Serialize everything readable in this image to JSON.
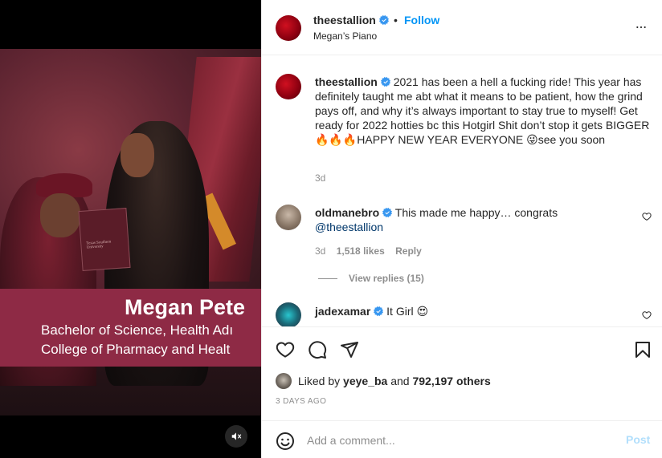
{
  "colors": {
    "accent": "#0095f6",
    "verified": "#3897f0",
    "mention": "#00376b",
    "muted": "#8e8e8e",
    "post_disabled": "#b2dffc",
    "lower_third": "#8e2a45"
  },
  "media": {
    "lower_third": {
      "name": "Megan Pete",
      "line1": "Bachelor of Science, Health Adı",
      "line2": "College of Pharmacy and Healt"
    },
    "diploma_text": "Texas Southern University",
    "mute_icon": "speaker-muted-icon"
  },
  "header": {
    "username": "theestallion",
    "dot": "•",
    "follow_label": "Follow",
    "subtitle": "Megan’s Piano",
    "more_icon": "more-horizontal-icon"
  },
  "caption": {
    "username": "theestallion",
    "text_part1": "2021 has been a hell a fucking ride! This year has definitely taught me abt what it means to be patient, how the grind pays off, and why it’s always important to stay true to myself! Get ready for 2022 hotties bc this Hotgirl Shit don’t stop it gets BIGGER",
    "emoji_fire": "🔥🔥🔥",
    "text_part2": "HAPPY NEW YEAR EVERYONE",
    "emoji_wink": "😜",
    "text_part3": "see you soon",
    "time": "3d"
  },
  "comments": [
    {
      "username": "oldmanebro",
      "text": "This made me happy… congrats",
      "mention": "@theestallion",
      "time": "3d",
      "likes": "1,518 likes",
      "reply_label": "Reply",
      "view_replies": "View replies (15)"
    },
    {
      "username": "jadexamar",
      "text": "It Girl",
      "emoji": "😍"
    }
  ],
  "actions": {
    "icons": [
      "heart-icon",
      "comment-icon",
      "share-icon",
      "bookmark-icon"
    ],
    "liked_by_prefix": "Liked by",
    "liked_by_user": "yeye_ba",
    "liked_by_and": "and",
    "liked_by_count": "792,197 others",
    "date": "3 DAYS AGO"
  },
  "add_comment": {
    "placeholder": "Add a comment...",
    "post_label": "Post",
    "emoji_icon": "smiley-icon"
  }
}
